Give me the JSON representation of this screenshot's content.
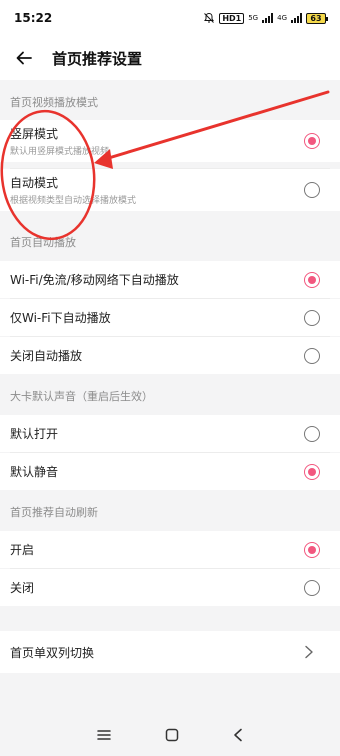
{
  "status_bar": {
    "time": "15:22",
    "hd_label": "HD1",
    "net_label_1": "5G",
    "net_label_2": "4G",
    "battery": "63",
    "icons": [
      "bell-muted-icon",
      "signal-icon",
      "battery-icon"
    ]
  },
  "header": {
    "title": "首页推荐设置",
    "back_icon": "arrow-left-icon"
  },
  "sections": [
    {
      "title": "首页视频播放模式",
      "options": [
        {
          "label": "竖屏模式",
          "sub": "默认用竖屏模式播放视频",
          "selected": true
        },
        {
          "label": "自动模式",
          "sub": "根据视频类型自动选择播放模式",
          "selected": false
        }
      ]
    },
    {
      "title": "首页自动播放",
      "options": [
        {
          "label": "Wi-Fi/免流/移动网络下自动播放",
          "selected": true
        },
        {
          "label": "仅Wi-Fi下自动播放",
          "selected": false
        },
        {
          "label": "关闭自动播放",
          "selected": false
        }
      ]
    },
    {
      "title": "大卡默认声音（重启后生效）",
      "options": [
        {
          "label": "默认打开",
          "selected": false
        },
        {
          "label": "默认静音",
          "selected": true
        }
      ]
    },
    {
      "title": "首页推荐自动刷新",
      "options": [
        {
          "label": "开启",
          "selected": true
        },
        {
          "label": "关闭",
          "selected": false
        }
      ]
    }
  ],
  "nav_row": {
    "label": "首页单双列切换",
    "icon": "chevron-right-icon"
  },
  "colors": {
    "accent": "#f2577f",
    "annotation_red": "#e8332d"
  },
  "system_nav": {
    "icons": [
      "menu-icon",
      "home-square-icon",
      "back-chevron-icon"
    ]
  }
}
